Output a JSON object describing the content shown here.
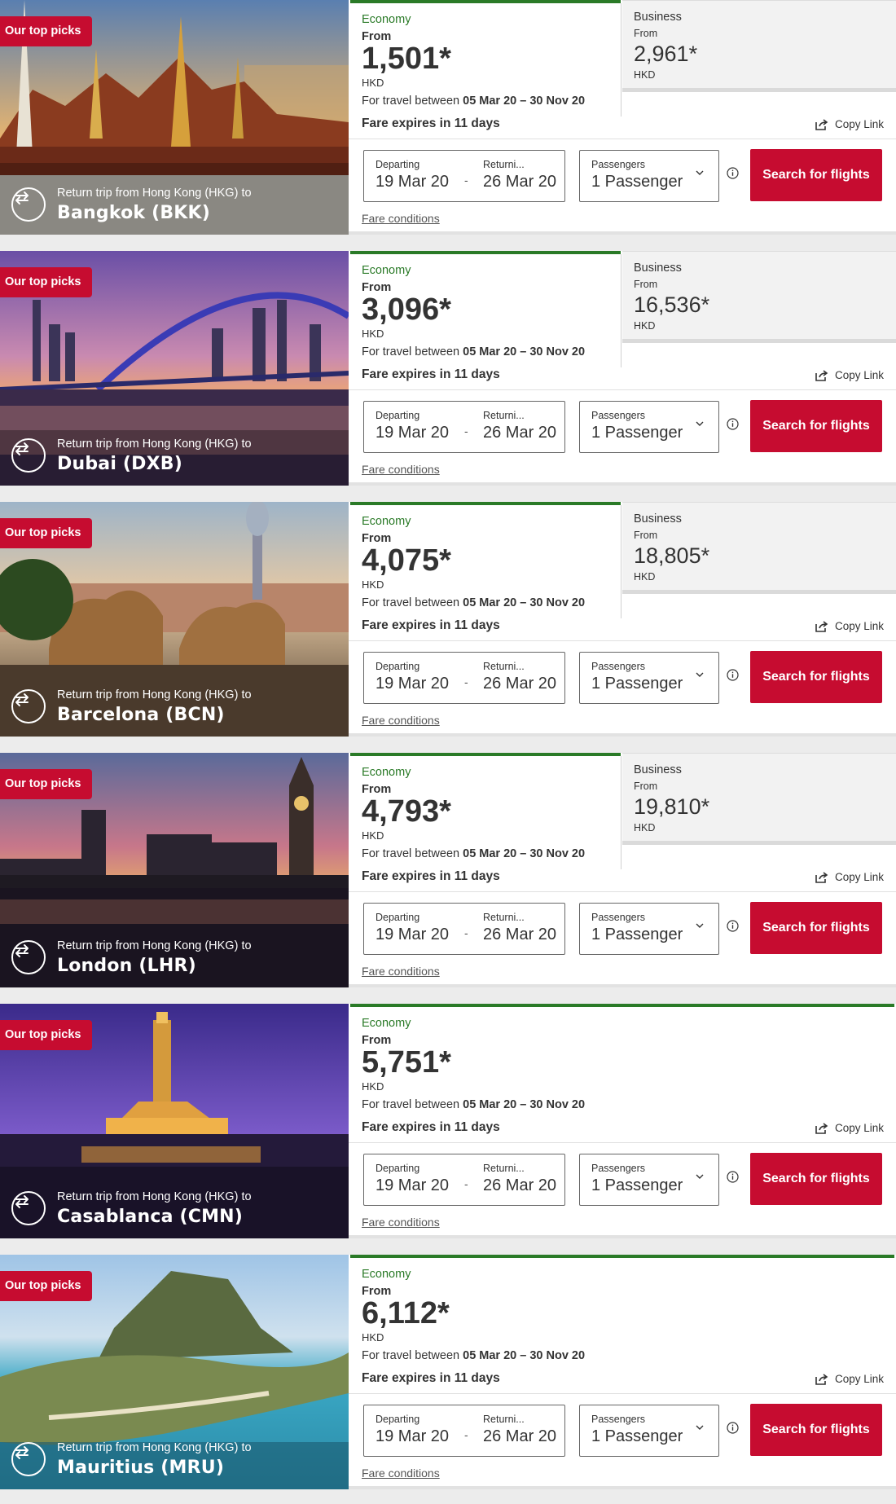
{
  "common": {
    "badge": "Our top picks",
    "route_prefix": "Return trip from Hong Kong (HKG) to",
    "economy_label": "Economy",
    "business_label": "Business",
    "from_label": "From",
    "currency": "HKD",
    "travel_prefix": "For travel between",
    "travel_dates": "05 Mar 20 – 30 Nov 20",
    "fare_expires": "Fare expires in 11 days",
    "copy_link": "Copy Link",
    "departing_label": "Departing",
    "returning_label": "Returni...",
    "departing_value": "19 Mar 20",
    "returning_value": "26 Mar 20",
    "date_separator": "-",
    "passengers_label": "Passengers",
    "passengers_value": "1 Passenger",
    "search_button": "Search for flights",
    "fare_conditions": "Fare conditions"
  },
  "deals": [
    {
      "city": "Bangkok (BKK)",
      "economy_price": "1,501*",
      "business_price": "2,961*",
      "scene": "temple"
    },
    {
      "city": "Dubai (DXB)",
      "economy_price": "3,096*",
      "business_price": "16,536*",
      "scene": "bridge"
    },
    {
      "city": "Barcelona (BCN)",
      "economy_price": "4,075*",
      "business_price": "18,805*",
      "scene": "park"
    },
    {
      "city": "London (LHR)",
      "economy_price": "4,793*",
      "business_price": "19,810*",
      "scene": "bigben"
    },
    {
      "city": "Casablanca (CMN)",
      "economy_price": "5,751*",
      "business_price": null,
      "scene": "mosque"
    },
    {
      "city": "Mauritius (MRU)",
      "economy_price": "6,112*",
      "business_price": null,
      "scene": "island"
    }
  ],
  "colors": {
    "brand_red": "#c60c30",
    "economy_green": "#2a7a27"
  }
}
